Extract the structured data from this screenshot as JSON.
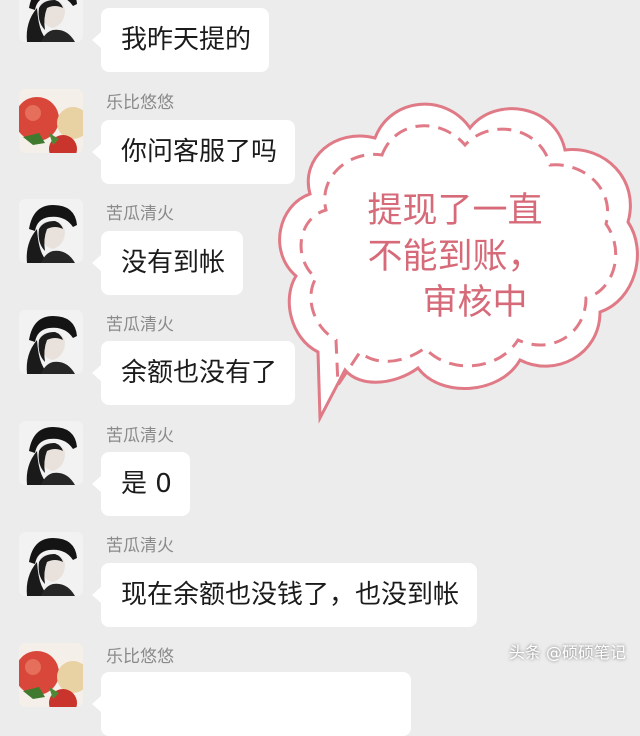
{
  "messages": [
    {
      "avatar": "dark-hood-avatar",
      "name": "",
      "text": "我昨天提的"
    },
    {
      "avatar": "tomato-avatar",
      "name": "乐比悠悠",
      "text": "你问客服了吗"
    },
    {
      "avatar": "dark-hood-avatar",
      "name": "苦瓜清火",
      "text": "没有到帐"
    },
    {
      "avatar": "dark-hood-avatar",
      "name": "苦瓜清火",
      "text": "余额也没有了"
    },
    {
      "avatar": "dark-hood-avatar",
      "name": "苦瓜清火",
      "text": "是 0"
    },
    {
      "avatar": "dark-hood-avatar",
      "name": "苦瓜清火",
      "text": "现在余额也没钱了，也没到帐"
    },
    {
      "avatar": "tomato-avatar",
      "name": "乐比悠悠",
      "text": ""
    }
  ],
  "callout": {
    "line1": "提现了一直",
    "line2": "不能到账，",
    "line3": "审核中",
    "border_color": "#e07a86",
    "text_color": "#d66a78"
  },
  "watermark": "头条 @硕硕笔记",
  "colors": {
    "background": "#ececec",
    "bubble": "#ffffff",
    "name_text": "#8a8a8a"
  }
}
